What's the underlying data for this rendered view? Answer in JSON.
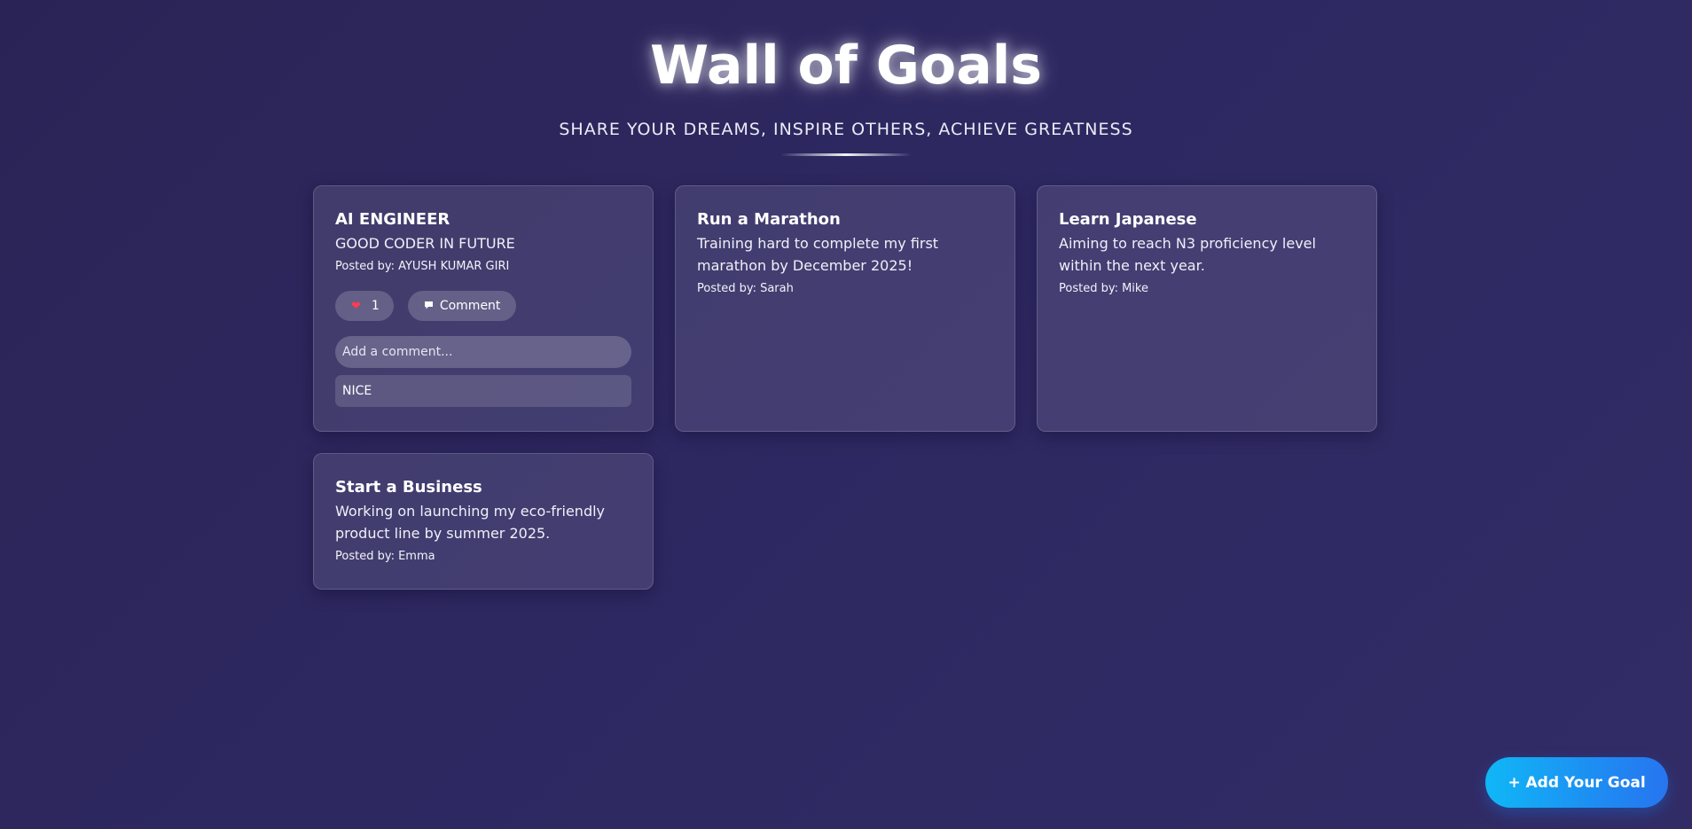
{
  "header": {
    "title": "Wall of Goals",
    "subtitle": "SHARE YOUR DREAMS, INSPIRE OTHERS, ACHIEVE GREATNESS"
  },
  "goals": [
    {
      "title": "AI ENGINEER",
      "description": "GOOD CODER IN FUTURE",
      "author": "Posted by: AYUSH KUMAR GIRI",
      "likes": "1",
      "comment_label": "Comment",
      "comment_placeholder": "Add a comment...",
      "comments": [
        "NICE"
      ]
    },
    {
      "title": "Run a Marathon",
      "description": "Training hard to complete my first marathon by December 2025!",
      "author": "Posted by: Sarah"
    },
    {
      "title": "Learn Japanese",
      "description": "Aiming to reach N3 proficiency level within the next year.",
      "author": "Posted by: Mike"
    },
    {
      "title": "Start a Business",
      "description": "Working on launching my eco-friendly product line by summer 2025.",
      "author": "Posted by: Emma"
    }
  ],
  "icons": {
    "like": "heart-icon",
    "comment": "speech-bubble-icon"
  },
  "add_goal_label": "+ Add Your Goal",
  "colors": {
    "background": "#2e2861",
    "accent_button": "#1d8df2",
    "heart": "#ff3b4e"
  }
}
